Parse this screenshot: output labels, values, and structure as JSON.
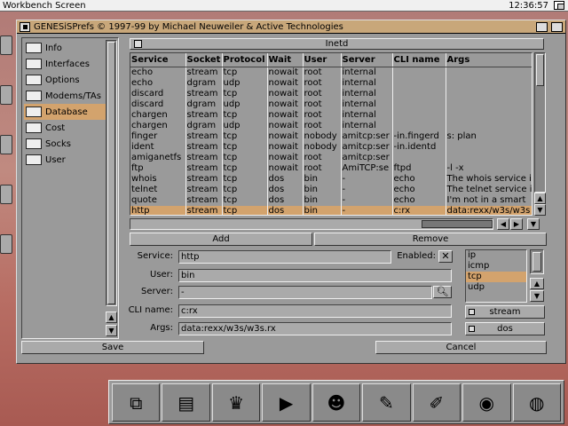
{
  "screen": {
    "title": "Workbench Screen",
    "clock": "12:36:57"
  },
  "window": {
    "title": "GENESiSPrefs © 1997-99 by Michael Neuweiler & Active Technologies"
  },
  "nav": {
    "items": [
      {
        "label": "Info",
        "icon": "info-icon"
      },
      {
        "label": "Interfaces",
        "icon": "interfaces-icon"
      },
      {
        "label": "Options",
        "icon": "options-icon"
      },
      {
        "label": "Modems/TAs",
        "icon": "modem-icon"
      },
      {
        "label": "Database",
        "icon": "database-icon"
      },
      {
        "label": "Cost",
        "icon": "cost-icon"
      },
      {
        "label": "Socks",
        "icon": "socks-icon"
      },
      {
        "label": "User",
        "icon": "user-icon"
      }
    ],
    "selected": "Database"
  },
  "section": {
    "title": "Inetd"
  },
  "table": {
    "headers": [
      "Service",
      "Socket",
      "Protocol",
      "Wait",
      "User",
      "Server",
      "CLI name",
      "Args"
    ],
    "rows": [
      [
        "echo",
        "stream",
        "tcp",
        "nowait",
        "root",
        "internal",
        "",
        ""
      ],
      [
        "echo",
        "dgram",
        "udp",
        "nowait",
        "root",
        "internal",
        "",
        ""
      ],
      [
        "discard",
        "stream",
        "tcp",
        "nowait",
        "root",
        "internal",
        "",
        ""
      ],
      [
        "discard",
        "dgram",
        "udp",
        "nowait",
        "root",
        "internal",
        "",
        ""
      ],
      [
        "chargen",
        "stream",
        "tcp",
        "nowait",
        "root",
        "internal",
        "",
        ""
      ],
      [
        "chargen",
        "dgram",
        "udp",
        "nowait",
        "root",
        "internal",
        "",
        ""
      ],
      [
        "finger",
        "stream",
        "tcp",
        "nowait",
        "nobody",
        "amitcp:ser",
        "-in.fingerd",
        "s: plan"
      ],
      [
        "ident",
        "stream",
        "tcp",
        "nowait",
        "nobody",
        "amitcp:ser",
        "-in.identd",
        ""
      ],
      [
        "amiganetfs",
        "stream",
        "tcp",
        "nowait",
        "root",
        "amitcp:ser",
        "",
        ""
      ],
      [
        "ftp",
        "stream",
        "tcp",
        "nowait",
        "root",
        "AmiTCP:se",
        "ftpd",
        "-l -x"
      ],
      [
        "whois",
        "stream",
        "tcp",
        "dos",
        "bin",
        "-",
        "echo",
        "The whois service i"
      ],
      [
        "telnet",
        "stream",
        "tcp",
        "dos",
        "bin",
        "-",
        "echo",
        "The telnet service i"
      ],
      [
        "quote",
        "stream",
        "tcp",
        "dos",
        "bin",
        "-",
        "echo",
        "I'm not in a smart"
      ],
      [
        "http",
        "stream",
        "tcp",
        "dos",
        "bin",
        "-",
        "c:rx",
        "data:rexx/w3s/w3s"
      ]
    ],
    "selected_row": 13
  },
  "buttons": {
    "add": "Add",
    "remove": "Remove",
    "save": "Save",
    "cancel": "Cancel"
  },
  "form": {
    "service_label": "Service:",
    "service_value": "http",
    "enabled_label": "Enabled:",
    "enabled_mark": "✕",
    "user_label": "User:",
    "user_value": "bin",
    "server_label": "Server:",
    "server_value": "-",
    "cliname_label": "CLI name:",
    "cliname_value": "c:rx",
    "args_label": "Args:",
    "args_value": "data:rexx/w3s/w3s.rx"
  },
  "protocols": {
    "options": [
      "ip",
      "icmp",
      "tcp",
      "udp"
    ],
    "selected": "tcp"
  },
  "socket_cycle": "stream",
  "wait_cycle": "dos",
  "dock": {
    "icons": [
      "disk-copy-icon",
      "editor-icon",
      "crown-icon",
      "play-icon",
      "hippo-icon",
      "paint-icon",
      "brush-icon",
      "eye-icon",
      "globe-icon"
    ]
  },
  "colors": {
    "accent": "#d3a36d",
    "panel": "#9a9a9a",
    "titlebar": "#c8a77a"
  }
}
